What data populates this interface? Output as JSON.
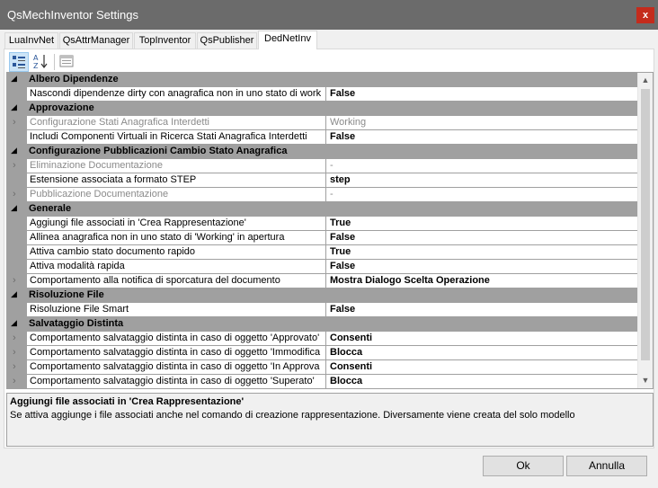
{
  "window": {
    "title": "QsMechInventor Settings",
    "close_glyph": "x"
  },
  "tabs": [
    {
      "label": "LuaInvNet"
    },
    {
      "label": "QsAttrManager"
    },
    {
      "label": "TopInventor"
    },
    {
      "label": "QsPublisher"
    },
    {
      "label": "DedNetInv",
      "active": true
    }
  ],
  "toolbar": {
    "categorized_icon": "categorized-view-icon",
    "alphabetical_icon": "alphabetical-sort-icon",
    "property_pages_icon": "property-pages-icon"
  },
  "categories": [
    {
      "label": "Albero Dipendenze",
      "rows": [
        {
          "name": "Nascondi dipendenze dirty con anagrafica non in uno stato di work",
          "value": "False",
          "readonly": false,
          "expandable": false
        }
      ]
    },
    {
      "label": "Approvazione",
      "rows": [
        {
          "name": "Configurazione Stati Anagrafica Interdetti",
          "value": "Working",
          "readonly": true,
          "expandable": true
        },
        {
          "name": "Includi Componenti Virtuali in Ricerca Stati Anagrafica Interdetti",
          "value": "False",
          "readonly": false,
          "expandable": false
        }
      ]
    },
    {
      "label": "Configurazione Pubblicazioni Cambio Stato Anagrafica",
      "rows": [
        {
          "name": "Eliminazione Documentazione",
          "value": "-",
          "readonly": true,
          "expandable": true
        },
        {
          "name": "Estensione associata a formato STEP",
          "value": "step",
          "readonly": false,
          "expandable": false
        },
        {
          "name": "Pubblicazione Documentazione",
          "value": "-",
          "readonly": true,
          "expandable": true
        }
      ]
    },
    {
      "label": "Generale",
      "rows": [
        {
          "name": "Aggiungi file associati in 'Crea Rappresentazione'",
          "value": "True",
          "readonly": false,
          "expandable": false
        },
        {
          "name": "Allinea anagrafica non in uno stato di 'Working' in apertura",
          "value": "False",
          "readonly": false,
          "expandable": false
        },
        {
          "name": "Attiva cambio stato documento rapido",
          "value": "True",
          "readonly": false,
          "expandable": false
        },
        {
          "name": "Attiva modalità rapida",
          "value": "False",
          "readonly": false,
          "expandable": false
        },
        {
          "name": "Comportamento alla notifica di sporcatura del documento",
          "value": "Mostra Dialogo Scelta Operazione",
          "readonly": false,
          "expandable": true
        }
      ]
    },
    {
      "label": "Risoluzione File",
      "rows": [
        {
          "name": "Risoluzione File Smart",
          "value": "False",
          "readonly": false,
          "expandable": false
        }
      ]
    },
    {
      "label": "Salvataggio Distinta",
      "rows": [
        {
          "name": "Comportamento salvataggio distinta in caso di oggetto 'Approvato'",
          "value": "Consenti",
          "readonly": false,
          "expandable": true
        },
        {
          "name": "Comportamento salvataggio distinta in caso di oggetto 'Immodifica",
          "value": "Blocca",
          "readonly": false,
          "expandable": true
        },
        {
          "name": "Comportamento salvataggio distinta in caso di oggetto 'In Approva",
          "value": "Consenti",
          "readonly": false,
          "expandable": true
        },
        {
          "name": "Comportamento salvataggio distinta in caso di oggetto 'Superato'",
          "value": "Blocca",
          "readonly": false,
          "expandable": true
        }
      ]
    }
  ],
  "help": {
    "title": "Aggiungi file associati in 'Crea Rappresentazione'",
    "description": "Se attiva aggiunge i file associati anche nel comando di creazione rappresentazione. Diversamente viene creata del solo modello"
  },
  "buttons": {
    "ok_label": "Ok",
    "cancel_label": "Annulla"
  },
  "colors": {
    "titlebar": "#6b6b6b",
    "close": "#c42b1c",
    "category_band": "#a0a0a0",
    "readonly_text": "#8a8a8a"
  }
}
